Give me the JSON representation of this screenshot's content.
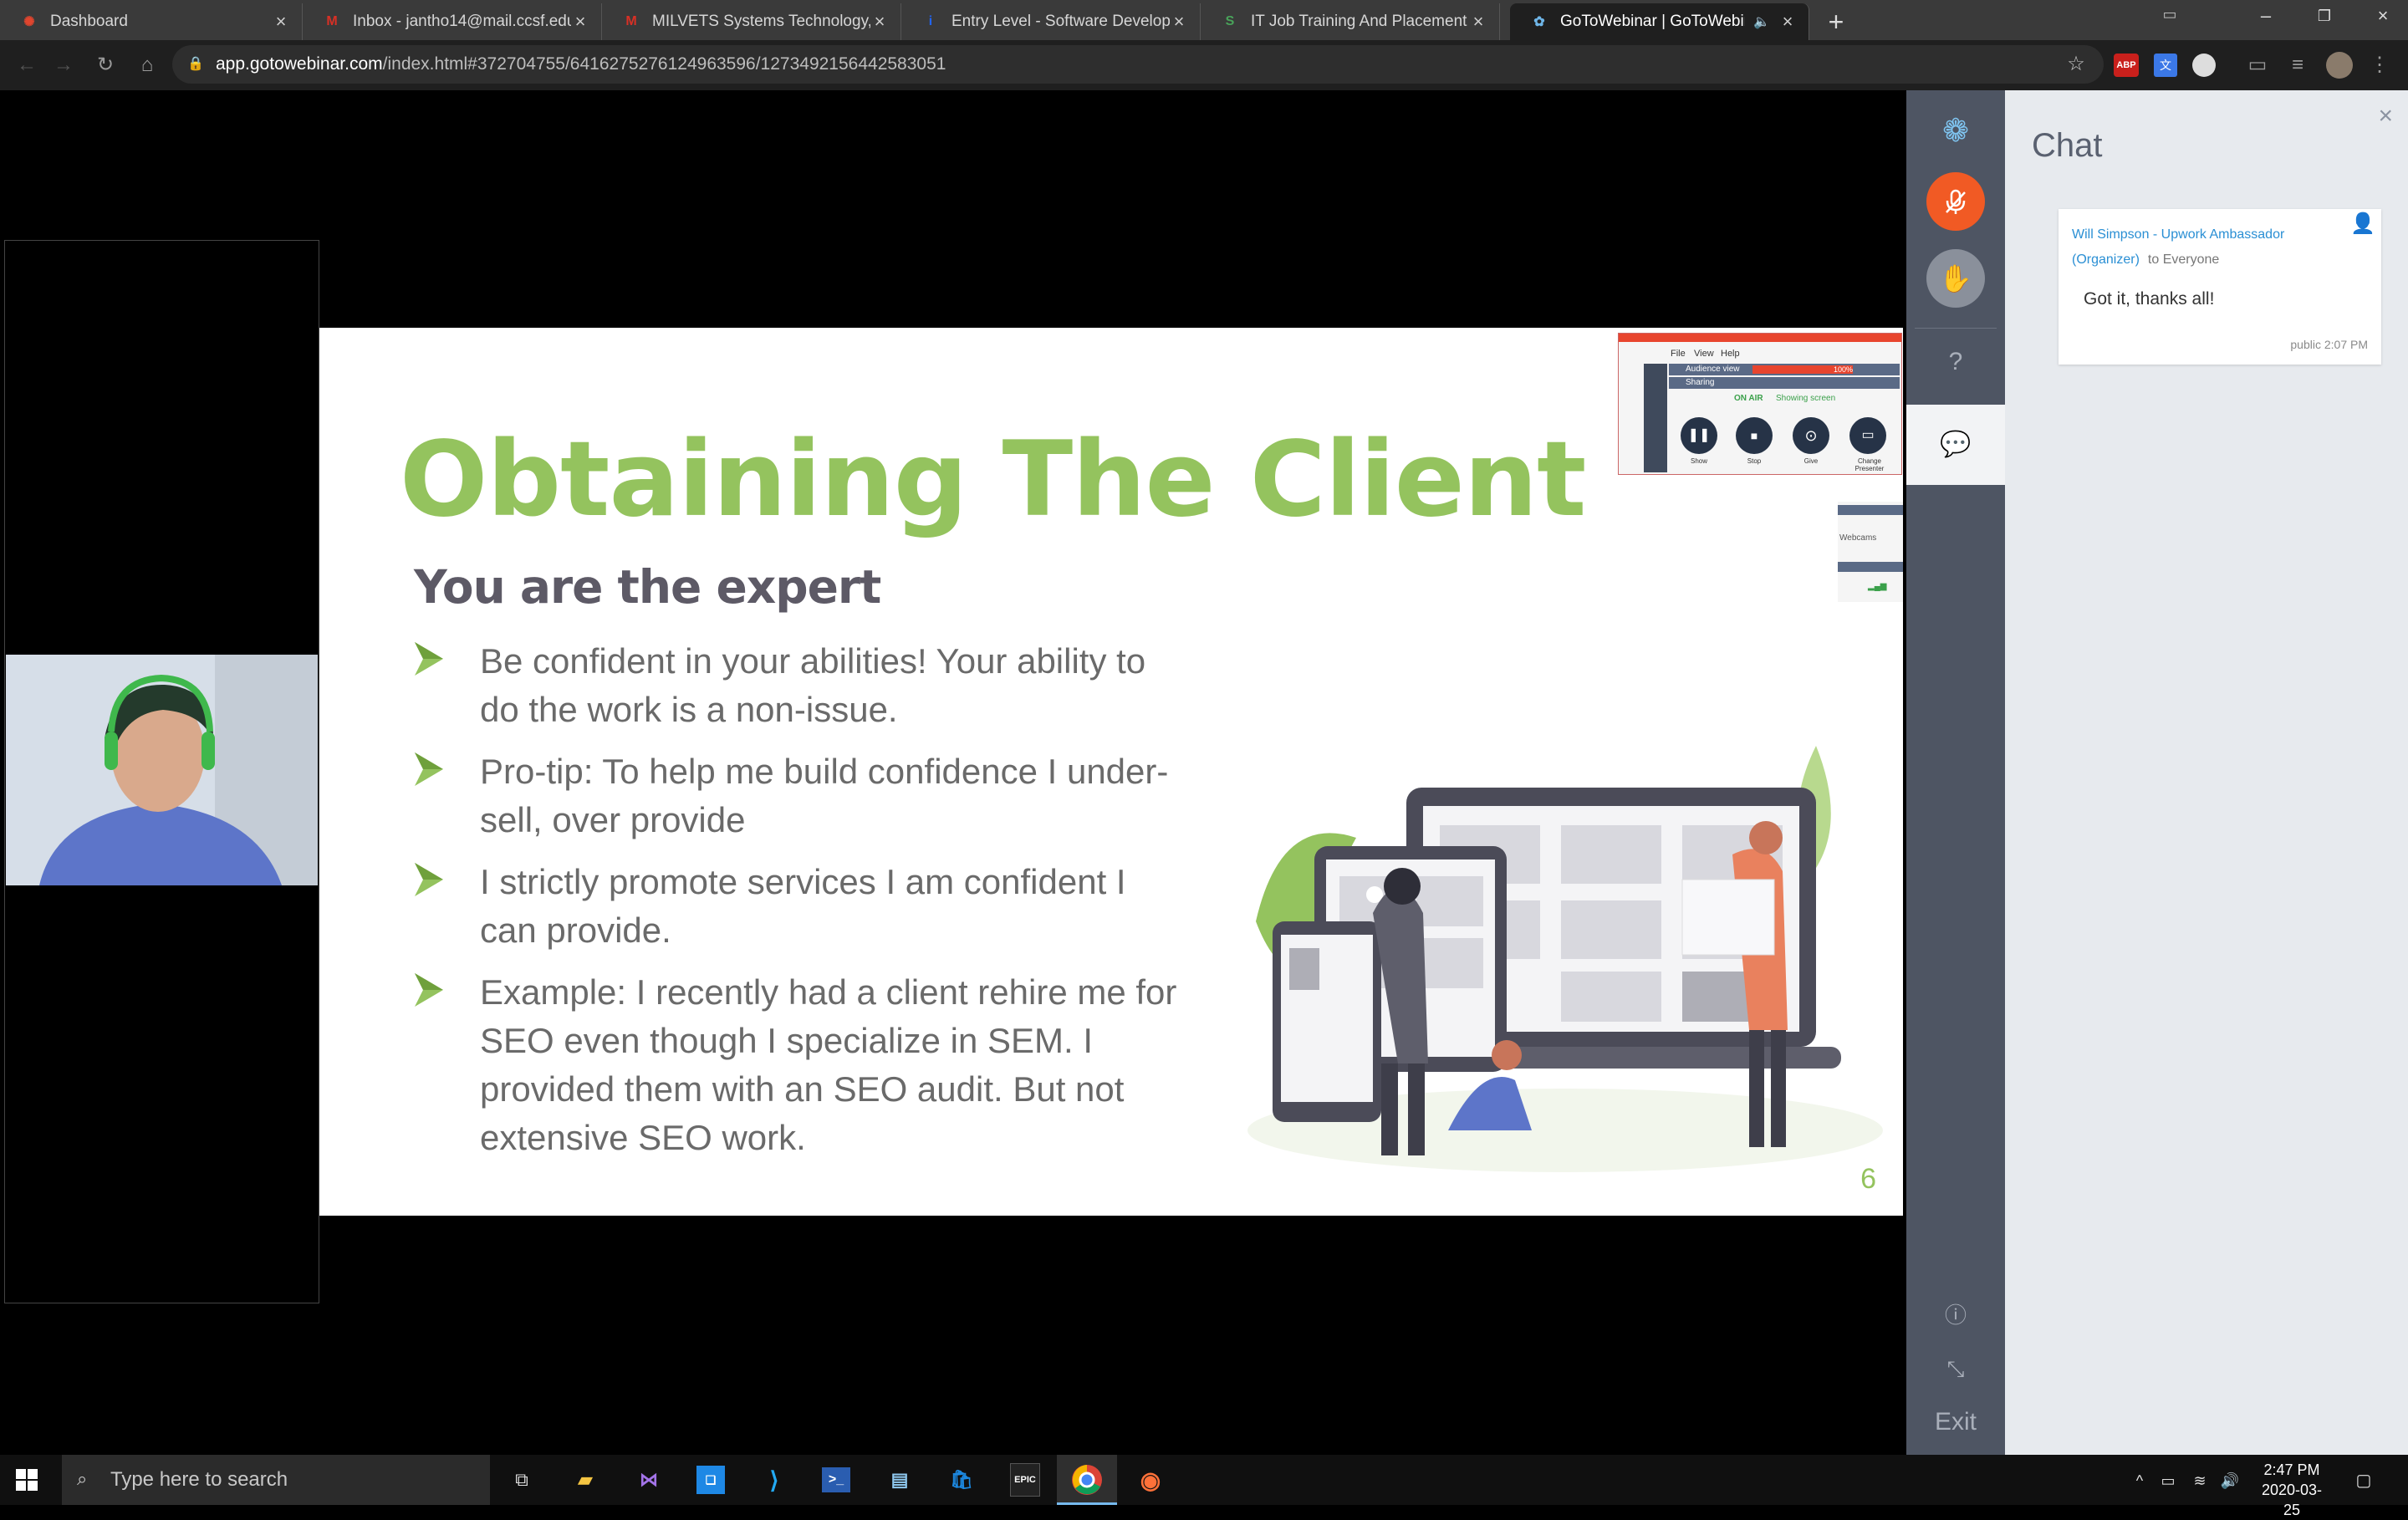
{
  "browser": {
    "tabs": [
      {
        "title": "Dashboard",
        "active": false,
        "icon": "asterisk-favicon",
        "color": "#e0452e"
      },
      {
        "title": "Inbox - jantho14@mail.ccsf.edu",
        "active": false,
        "icon": "gmail-favicon",
        "color": "#d93025"
      },
      {
        "title": "MILVETS Systems Technology, Inc",
        "active": false,
        "icon": "gmail-favicon",
        "color": "#d93025"
      },
      {
        "title": "Entry Level - Software Developer",
        "active": false,
        "icon": "indeed-favicon",
        "color": "#2164f3"
      },
      {
        "title": "IT Job Training And Placement | S",
        "active": false,
        "icon": "synergisticit-favicon",
        "color": "#49a35a"
      },
      {
        "title": "GoToWebinar | GoToWebinar",
        "active": true,
        "icon": "gotowebinar-favicon",
        "color": "#6fb6e8"
      }
    ],
    "url_host": "app.gotowebinar.com",
    "url_path": "/index.html#372704755/6416275276124963596/1273492156442583051"
  },
  "slide": {
    "title": "Obtaining The Client",
    "subtitle": "You are the expert",
    "bullets": [
      "Be confident in your abilities! Your ability to do the work is a non-issue.",
      "Pro-tip: To help me build confidence I under-sell, over provide",
      "I strictly promote services I am confident I can provide.",
      "Example: I recently had a client rehire me for SEO even though I specialize in SEM. I provided them with an SEO audit. But not extensive SEO work."
    ],
    "page_number": "6",
    "accent": "#94c35e"
  },
  "presenter_widget": {
    "menu": [
      "File",
      "View",
      "Help"
    ],
    "audience_view": "Audience view",
    "zoom": "100%",
    "sharing": "Sharing",
    "on_air": "ON AIR",
    "showing": "Showing screen",
    "controls": [
      "Show",
      "Stop",
      "Give",
      "Change Presenter"
    ],
    "webcams": "Webcams"
  },
  "rail": {
    "exit_label": "Exit",
    "mic_color": "#f15a24"
  },
  "chat": {
    "title": "Chat",
    "messages": [
      {
        "sender": "Will Simpson - Upwork Ambassador (Organizer)",
        "to": "to Everyone",
        "text": "Got it, thanks all!",
        "meta": "public 2:07 PM"
      }
    ]
  },
  "taskbar": {
    "search_placeholder": "Type here to search",
    "time": "2:47 PM",
    "date": "2020-03-25",
    "apps": [
      "task-view",
      "file-explorer",
      "visual-studio",
      "jetbrains",
      "vscode",
      "powershell",
      "notepad",
      "store",
      "epic-games",
      "chrome",
      "firefox"
    ]
  }
}
